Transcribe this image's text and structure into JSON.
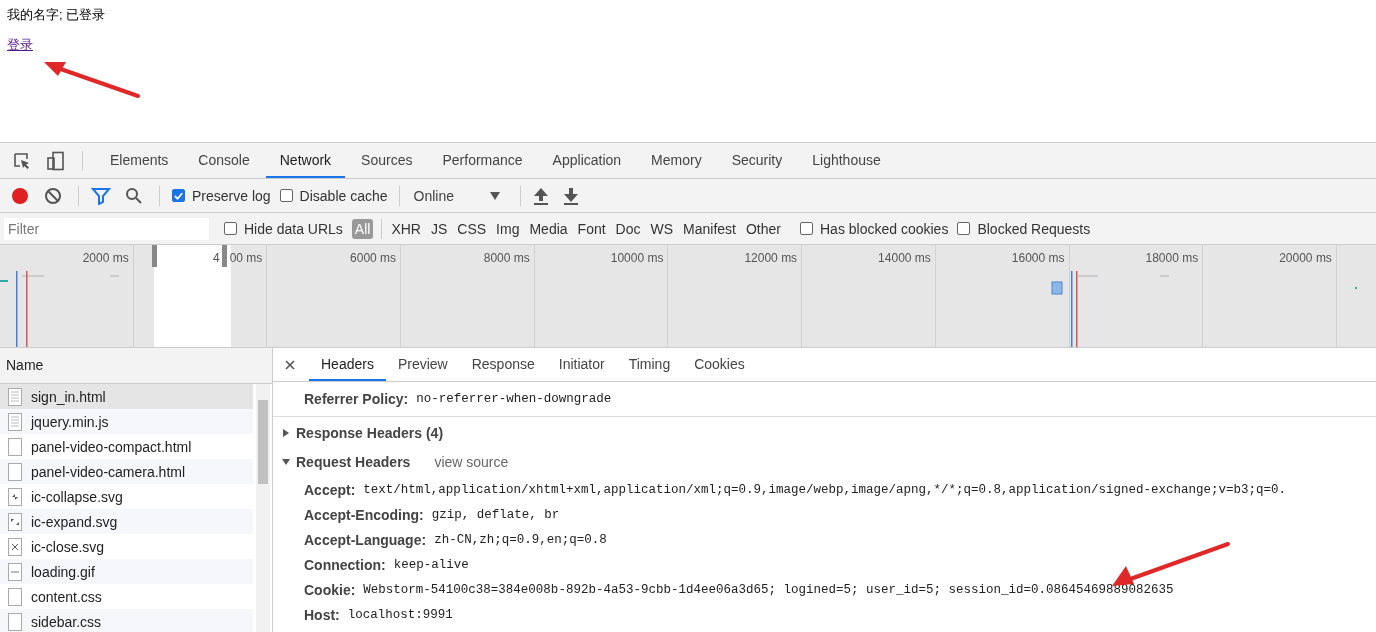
{
  "page": {
    "status_text": "我的名字; 已登录",
    "link": "登录"
  },
  "panel_tabs": [
    {
      "label": "Elements",
      "selected": false
    },
    {
      "label": "Console",
      "selected": false
    },
    {
      "label": "Network",
      "selected": true
    },
    {
      "label": "Sources",
      "selected": false
    },
    {
      "label": "Performance",
      "selected": false
    },
    {
      "label": "Application",
      "selected": false
    },
    {
      "label": "Memory",
      "selected": false
    },
    {
      "label": "Security",
      "selected": false
    },
    {
      "label": "Lighthouse",
      "selected": false
    }
  ],
  "toolbar": {
    "recording": true,
    "preserve_log": {
      "label": "Preserve log",
      "checked": true
    },
    "disable_cache": {
      "label": "Disable cache",
      "checked": false
    },
    "throttling": "Online"
  },
  "filter_bar": {
    "placeholder": "Filter",
    "hide_data_urls": {
      "label": "Hide data URLs",
      "checked": false
    },
    "types": [
      {
        "label": "All",
        "selected": true
      },
      {
        "label": "XHR",
        "selected": false
      },
      {
        "label": "JS",
        "selected": false
      },
      {
        "label": "CSS",
        "selected": false
      },
      {
        "label": "Img",
        "selected": false
      },
      {
        "label": "Media",
        "selected": false
      },
      {
        "label": "Font",
        "selected": false
      },
      {
        "label": "Doc",
        "selected": false
      },
      {
        "label": "WS",
        "selected": false
      },
      {
        "label": "Manifest",
        "selected": false
      },
      {
        "label": "Other",
        "selected": false
      }
    ],
    "has_blocked_cookies": {
      "label": "Has blocked cookies",
      "checked": false
    },
    "blocked_requests": {
      "label": "Blocked Requests",
      "checked": false
    }
  },
  "overview": {
    "ticks": [
      {
        "label": "2000 ms"
      },
      {
        "label": "4",
        "label_rest": "00 ms"
      },
      {
        "label": "6000 ms"
      },
      {
        "label": "8000 ms"
      },
      {
        "label": "10000 ms"
      },
      {
        "label": "12000 ms"
      },
      {
        "label": "14000 ms"
      },
      {
        "label": "16000 ms"
      },
      {
        "label": "18000 ms"
      },
      {
        "label": "20000 ms"
      }
    ]
  },
  "requests": {
    "column": "Name",
    "rows": [
      {
        "name": "sign_in.html",
        "kind": "document",
        "selected": true
      },
      {
        "name": "jquery.min.js",
        "kind": "document",
        "selected": false
      },
      {
        "name": "panel-video-compact.html",
        "kind": "blank",
        "selected": false
      },
      {
        "name": "panel-video-camera.html",
        "kind": "blank",
        "selected": false
      },
      {
        "name": "ic-collapse.svg",
        "kind": "collapse",
        "selected": false
      },
      {
        "name": "ic-expand.svg",
        "kind": "expand",
        "selected": false
      },
      {
        "name": "ic-close.svg",
        "kind": "close",
        "selected": false
      },
      {
        "name": "loading.gif",
        "kind": "gif",
        "selected": false
      },
      {
        "name": "content.css",
        "kind": "blank",
        "selected": false
      },
      {
        "name": "sidebar.css",
        "kind": "blank",
        "selected": false
      }
    ]
  },
  "details": {
    "tabs": [
      {
        "label": "Headers",
        "selected": true
      },
      {
        "label": "Preview",
        "selected": false
      },
      {
        "label": "Response",
        "selected": false
      },
      {
        "label": "Initiator",
        "selected": false
      },
      {
        "label": "Timing",
        "selected": false
      },
      {
        "label": "Cookies",
        "selected": false
      }
    ],
    "referrer_policy": {
      "name": "Referrer Policy:",
      "value": "no-referrer-when-downgrade"
    },
    "response_headers": {
      "title": "Response Headers (4)",
      "expanded": false
    },
    "request_headers": {
      "title": "Request Headers",
      "expanded": true,
      "link": "view source",
      "rows": [
        {
          "name": "Accept:",
          "value": "text/html,application/xhtml+xml,application/xml;q=0.9,image/webp,image/apng,*/*;q=0.8,application/signed-exchange;v=b3;q=0."
        },
        {
          "name": "Accept-Encoding:",
          "value": "gzip, deflate, br"
        },
        {
          "name": "Accept-Language:",
          "value": "zh-CN,zh;q=0.9,en;q=0.8"
        },
        {
          "name": "Connection:",
          "value": "keep-alive"
        },
        {
          "name": "Cookie:",
          "value": "Webstorm-54100c38=384e008b-892b-4a53-9cbb-1d4ee06a3d65; logined=5; user_id=5; session_id=0.08645469889082635"
        },
        {
          "name": "Host:",
          "value": "localhost:9991"
        }
      ]
    }
  }
}
